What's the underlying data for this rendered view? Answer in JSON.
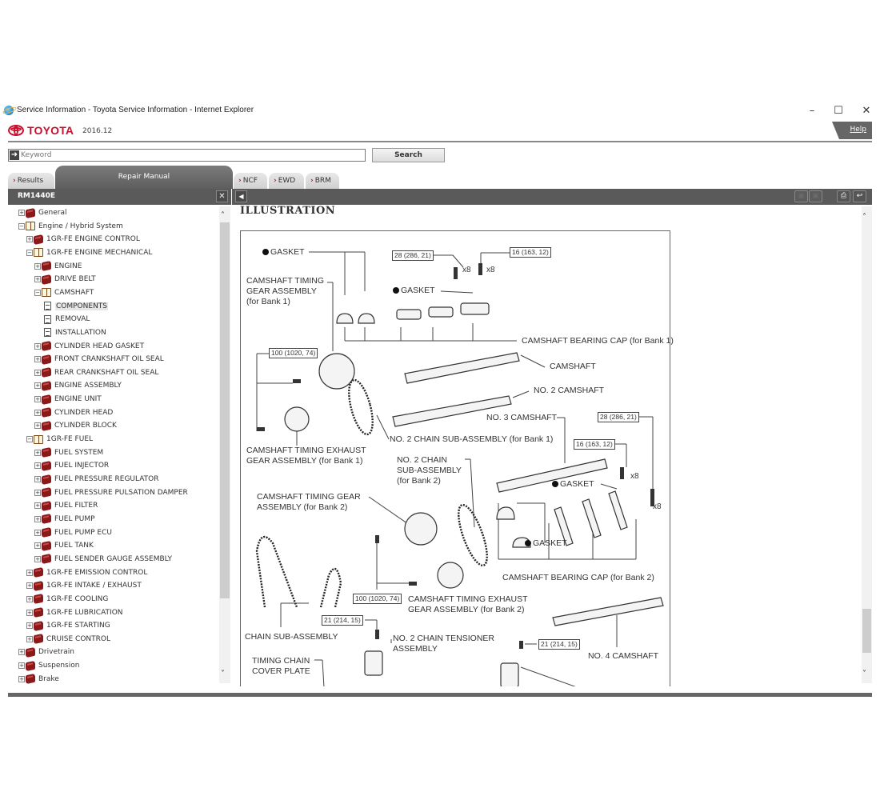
{
  "window": {
    "title": "Service Information - Toyota Service Information - Internet Explorer",
    "minimize_glyph": "–",
    "maximize_glyph": "☐",
    "close_glyph": "✕"
  },
  "header": {
    "brand": "TOYOTA",
    "version": "2016.12",
    "help_label": "Help"
  },
  "search": {
    "placeholder": "Keyword",
    "value": "",
    "button_label": "Search"
  },
  "tabs": [
    {
      "label": "Results",
      "active": false
    },
    {
      "label": "Repair Manual",
      "active": true
    },
    {
      "label": "NCF",
      "active": false
    },
    {
      "label": "EWD",
      "active": false
    },
    {
      "label": "BRM",
      "active": false
    }
  ],
  "left_panel": {
    "manual_code": "RM1440E",
    "close_glyph": "✕"
  },
  "tree": [
    {
      "label": "General",
      "level": 0,
      "type": "closed"
    },
    {
      "label": "Engine / Hybrid System",
      "level": 0,
      "type": "open"
    },
    {
      "label": "1GR-FE ENGINE CONTROL",
      "level": 1,
      "type": "closed"
    },
    {
      "label": "1GR-FE ENGINE MECHANICAL",
      "level": 1,
      "type": "open"
    },
    {
      "label": "ENGINE",
      "level": 2,
      "type": "closed"
    },
    {
      "label": "DRIVE BELT",
      "level": 2,
      "type": "closed"
    },
    {
      "label": "CAMSHAFT",
      "level": 2,
      "type": "open"
    },
    {
      "label": "COMPONENTS",
      "level": 3,
      "type": "doc",
      "selected": true
    },
    {
      "label": "REMOVAL",
      "level": 3,
      "type": "doc"
    },
    {
      "label": "INSTALLATION",
      "level": 3,
      "type": "doc"
    },
    {
      "label": "CYLINDER HEAD GASKET",
      "level": 2,
      "type": "closed"
    },
    {
      "label": "FRONT CRANKSHAFT OIL SEAL",
      "level": 2,
      "type": "closed"
    },
    {
      "label": "REAR CRANKSHAFT OIL SEAL",
      "level": 2,
      "type": "closed"
    },
    {
      "label": "ENGINE ASSEMBLY",
      "level": 2,
      "type": "closed"
    },
    {
      "label": "ENGINE UNIT",
      "level": 2,
      "type": "closed"
    },
    {
      "label": "CYLINDER HEAD",
      "level": 2,
      "type": "closed"
    },
    {
      "label": "CYLINDER BLOCK",
      "level": 2,
      "type": "closed"
    },
    {
      "label": "1GR-FE FUEL",
      "level": 1,
      "type": "open"
    },
    {
      "label": "FUEL SYSTEM",
      "level": 2,
      "type": "closed"
    },
    {
      "label": "FUEL INJECTOR",
      "level": 2,
      "type": "closed"
    },
    {
      "label": "FUEL PRESSURE REGULATOR",
      "level": 2,
      "type": "closed"
    },
    {
      "label": "FUEL PRESSURE PULSATION DAMPER",
      "level": 2,
      "type": "closed"
    },
    {
      "label": "FUEL FILTER",
      "level": 2,
      "type": "closed"
    },
    {
      "label": "FUEL PUMP",
      "level": 2,
      "type": "closed"
    },
    {
      "label": "FUEL PUMP ECU",
      "level": 2,
      "type": "closed"
    },
    {
      "label": "FUEL TANK",
      "level": 2,
      "type": "closed"
    },
    {
      "label": "FUEL SENDER GAUGE ASSEMBLY",
      "level": 2,
      "type": "closed"
    },
    {
      "label": "1GR-FE EMISSION CONTROL",
      "level": 1,
      "type": "closed"
    },
    {
      "label": "1GR-FE INTAKE / EXHAUST",
      "level": 1,
      "type": "closed"
    },
    {
      "label": "1GR-FE COOLING",
      "level": 1,
      "type": "closed"
    },
    {
      "label": "1GR-FE LUBRICATION",
      "level": 1,
      "type": "closed"
    },
    {
      "label": "1GR-FE STARTING",
      "level": 1,
      "type": "closed"
    },
    {
      "label": "CRUISE CONTROL",
      "level": 1,
      "type": "closed"
    },
    {
      "label": "Drivetrain",
      "level": 0,
      "type": "closed"
    },
    {
      "label": "Suspension",
      "level": 0,
      "type": "closed"
    },
    {
      "label": "Brake",
      "level": 0,
      "type": "closed"
    }
  ],
  "content": {
    "heading": "ILLUSTRATION",
    "labels": {
      "gasket_1": "GASKET",
      "cam_timing_gear_b1": "CAMSHAFT TIMING\nGEAR ASSEMBLY\n(for Bank 1)",
      "gasket_2": "GASKET",
      "bearing_cap_b1": "CAMSHAFT BEARING CAP (for Bank 1)",
      "camshaft": "CAMSHAFT",
      "no2_camshaft": "NO. 2 CAMSHAFT",
      "no3_camshaft": "NO. 3 CAMSHAFT",
      "no2_chain_b1": "NO. 2 CHAIN SUB-ASSEMBLY (for Bank 1)",
      "cam_exhaust_b1": "CAMSHAFT TIMING EXHAUST\nGEAR ASSEMBLY (for Bank 1)",
      "no2_chain_b2": "NO. 2 CHAIN\nSUB-ASSEMBLY\n(for Bank 2)",
      "gasket_3": "GASKET",
      "cam_timing_gear_b2": "CAMSHAFT TIMING GEAR\nASSEMBLY (for Bank 2)",
      "gasket_4": "GASKET",
      "bearing_cap_b2": "CAMSHAFT BEARING CAP (for Bank 2)",
      "cam_exhaust_b2": "CAMSHAFT TIMING EXHAUST\nGEAR ASSEMBLY (for Bank 2)",
      "chain_sub": "CHAIN SUB-ASSEMBLY",
      "no2_tensioner": "NO. 2 CHAIN TENSIONER\nASSEMBLY",
      "timing_cover": "TIMING CHAIN\nCOVER PLATE",
      "no4_camshaft": "NO. 4 CAMSHAFT"
    },
    "torques": {
      "t1": "28 (286, 21)",
      "t2": "16 (163, 12)",
      "t3": "100 (1020, 74)",
      "t4": "28 (286, 21)",
      "t5": "16 (163, 12)",
      "t6": "100 (1020, 74)",
      "t7": "21 (214, 15)",
      "t8": "21 (214, 15)"
    },
    "quantities": {
      "q1": "x8",
      "q2": "x8",
      "q3": "x8",
      "q4": "x8"
    }
  },
  "toolbar": {
    "back_glyph": "◀",
    "print_glyph": "⎙",
    "return_glyph": "↩"
  },
  "scroll": {
    "up_glyph": "˄",
    "down_glyph": "˅"
  }
}
